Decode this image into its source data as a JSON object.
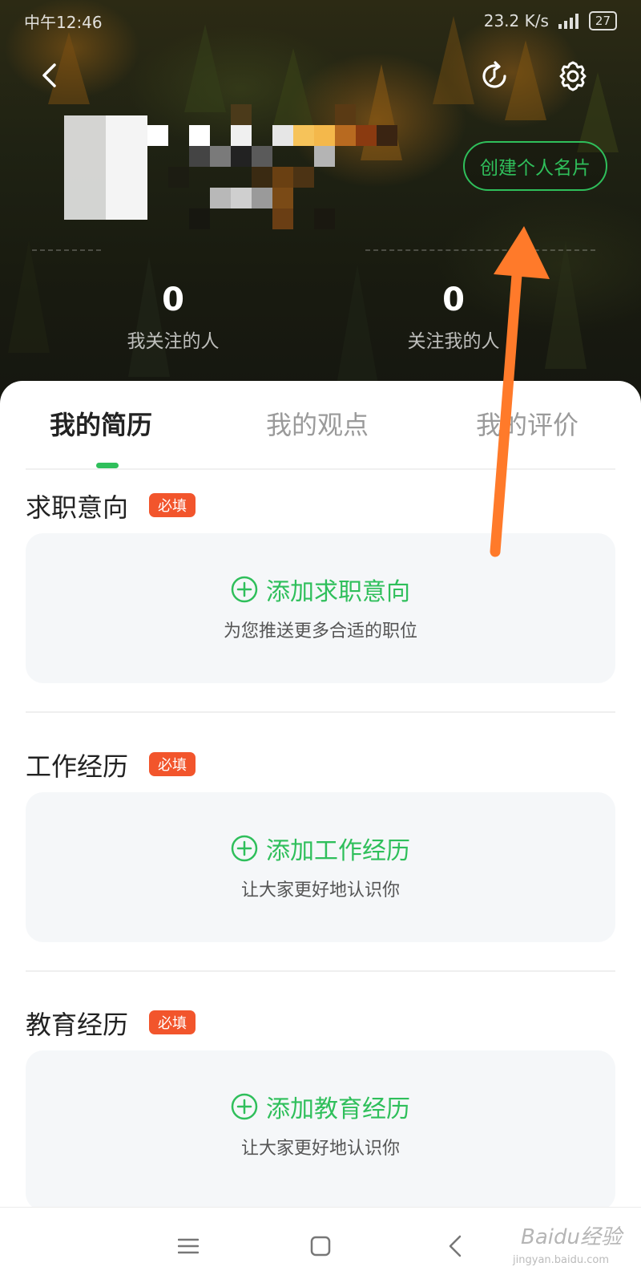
{
  "status_bar": {
    "time": "中午12:46",
    "net_speed": "23.2 K/s",
    "battery": "27"
  },
  "header": {
    "create_card_label": "创建个人名片",
    "following_count": "0",
    "following_label": "我关注的人",
    "followers_count": "0",
    "followers_label": "关注我的人"
  },
  "tabs": [
    {
      "label": "我的简历",
      "active": true
    },
    {
      "label": "我的观点",
      "active": false
    },
    {
      "label": "我的评价",
      "active": false
    }
  ],
  "sections": [
    {
      "title": "求职意向",
      "badge": "必填",
      "add_label": "添加求职意向",
      "hint": "为您推送更多合适的职位"
    },
    {
      "title": "工作经历",
      "badge": "必填",
      "add_label": "添加工作经历",
      "hint": "让大家更好地认识你"
    },
    {
      "title": "教育经历",
      "badge": "必填",
      "add_label": "添加教育经历",
      "hint": "让大家更好地认识你"
    }
  ],
  "watermark": {
    "brand": "Baidu经验",
    "url": "jingyan.baidu.com"
  },
  "colors": {
    "accent_green": "#2fbf5b",
    "required_badge": "#f2552c",
    "annotation_arrow": "#ff7a2a",
    "card_bg": "#f5f7f9"
  },
  "icons": [
    "back-arrow-icon",
    "refresh-icon",
    "gear-icon",
    "plus-circle-icon",
    "menu-icon",
    "home-square-icon",
    "nav-back-icon"
  ]
}
